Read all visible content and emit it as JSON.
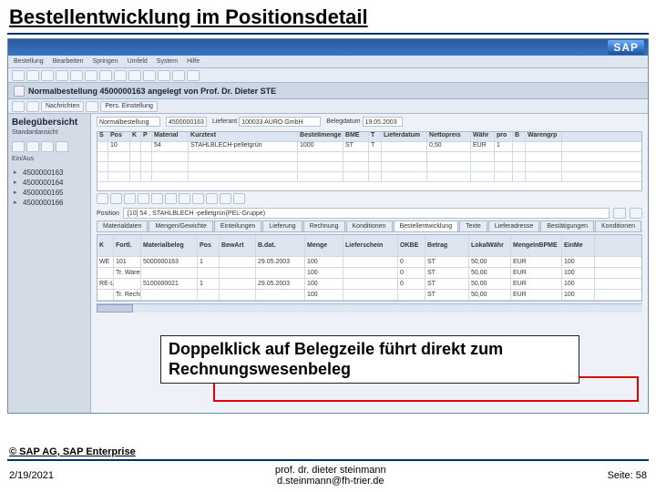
{
  "slide": {
    "title": "Bestellentwicklung im Positionsdetail",
    "annotation": "Doppelklick auf Belegzeile führt direkt zum Rechnungswesenbeleg",
    "copyright": "© SAP AG, SAP Enterprise",
    "footer_date": "2/19/2021",
    "footer_author_line1": "prof. dr. dieter steinmann",
    "footer_author_line2": "d.steinmann@fh-trier.de",
    "footer_page": "Seite: 58"
  },
  "sap": {
    "brand": "SAP",
    "menubar": [
      "Bestellung",
      "Bearbeiten",
      "Springen",
      "Umfeld",
      "System",
      "Hilfe"
    ],
    "doc_header_text": "Normalbestellung 4500000163 angelegt von Prof. Dr. Dieter STE",
    "left": {
      "title": "Belegübersicht",
      "subtitle": "Standardansicht",
      "tree_toggle": "Ein/Aus",
      "items": [
        "4500000163",
        "4500000164",
        "4500000165",
        "4500000166"
      ]
    },
    "head": {
      "type_label": "Normalbestellung",
      "doc_label": "",
      "doc_val": "4500000163",
      "vendor_label": "Lieferant",
      "vendor_val": "100033 AURO GmbH",
      "date_label": "Belegdatum",
      "date_val": "19.05.2003"
    },
    "items": {
      "cols": [
        "S",
        "Pos",
        "K",
        "P",
        "Material",
        "Kurztext",
        "Bestellmenge",
        "BME",
        "T",
        "Lieferdatum",
        "Nettopreis",
        "Währ",
        "pro",
        "B",
        "Warengrp"
      ],
      "widths": [
        12,
        24,
        12,
        12,
        40,
        120,
        50,
        28,
        14,
        50,
        48,
        26,
        20,
        14,
        40
      ],
      "rows": [
        [
          "",
          "10",
          "",
          "",
          "54",
          "STAHLBLECH-pelletgrün",
          "1000",
          "ST",
          "T",
          "",
          "0,50",
          "EUR",
          "1",
          "",
          ""
        ]
      ]
    },
    "position_bar": "[10] 54 , STAHLBLECH -pelletgrün(PEL-Gruppe)",
    "tabs": [
      "Materialdaten",
      "Mengen/Gewichte",
      "Einteilungen",
      "Lieferung",
      "Rechnung",
      "Konditionen",
      "Bestellentwicklung",
      "Texte",
      "Lieferadresse",
      "Bestätigungen",
      "Konditionen"
    ],
    "active_tab_index": 6,
    "dev": {
      "cols": [
        "K",
        "Fortl.",
        "Materialbeleg",
        "Pos",
        "BewArt",
        "B.dat.",
        "Menge",
        "Lieferschein",
        "OKBE",
        "Betrag",
        "LokalWähr",
        "MengeInBPME",
        "EinMe"
      ],
      "widths": [
        18,
        30,
        62,
        24,
        40,
        54,
        42,
        60,
        30,
        48,
        46,
        56,
        36
      ],
      "rows": [
        [
          "WE",
          "101",
          "5000000163",
          "1",
          "",
          "29.05.2003",
          "100",
          "",
          "0",
          "ST",
          "50,00",
          "EUR",
          "100"
        ],
        [
          "",
          "Tr. Wareneingang",
          "",
          "",
          "",
          "",
          "100",
          "",
          "0",
          "ST",
          "50,00",
          "EUR",
          "100"
        ],
        [
          "RE-L",
          "",
          "5100000021",
          "1",
          "",
          "29.05.2003",
          "100",
          "",
          "0",
          "ST",
          "50,00",
          "EUR",
          "100"
        ],
        [
          "",
          "Tr. Rechnungseingang",
          "",
          "",
          "",
          "",
          "100",
          "",
          "",
          "ST",
          "50,00",
          "EUR",
          "100"
        ]
      ]
    },
    "status": {
      "mode": "",
      "code": ""
    }
  }
}
